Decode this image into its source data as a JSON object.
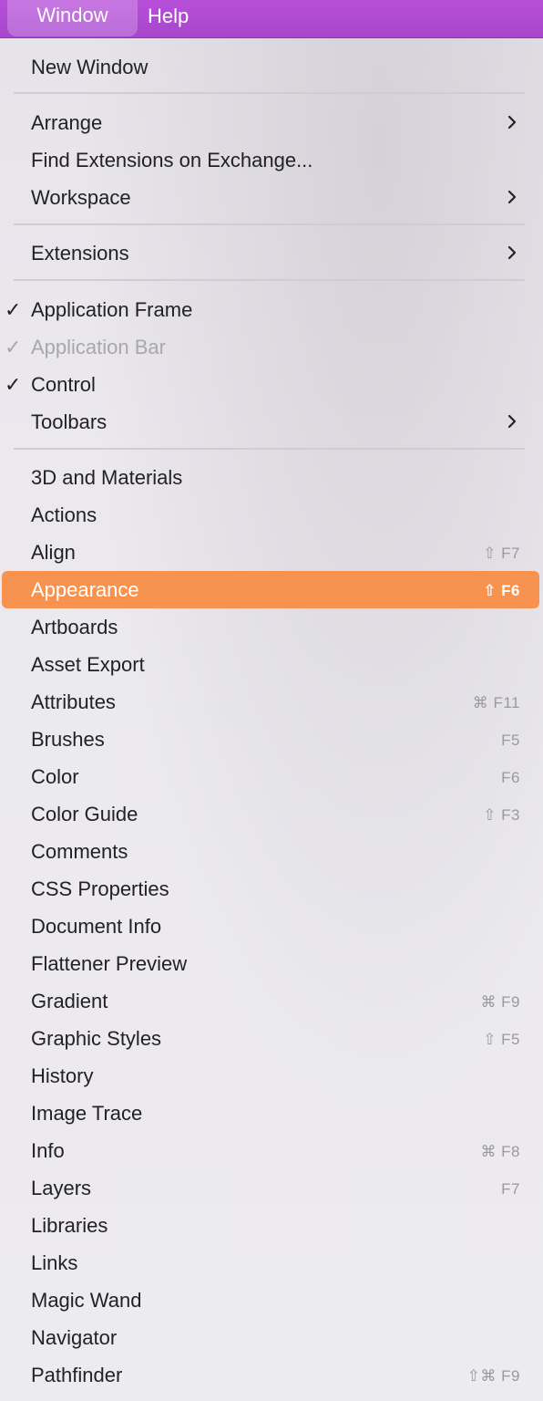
{
  "menubar": {
    "window_label": "Window",
    "help_label": "Help"
  },
  "menu": {
    "items": [
      {
        "label": "New Window"
      },
      {
        "label": "Arrange",
        "submenu": true
      },
      {
        "label": "Find Extensions on Exchange..."
      },
      {
        "label": "Workspace",
        "submenu": true
      },
      {
        "label": "Extensions",
        "submenu": true
      },
      {
        "label": "Application Frame",
        "checked": true
      },
      {
        "label": "Application Bar",
        "checked": true,
        "disabled": true
      },
      {
        "label": "Control",
        "checked": true
      },
      {
        "label": "Toolbars",
        "submenu": true
      },
      {
        "label": "3D and Materials"
      },
      {
        "label": "Actions"
      },
      {
        "label": "Align",
        "shortcut": "⇧ F7"
      },
      {
        "label": "Appearance",
        "shortcut": "⇧ F6",
        "highlighted": true
      },
      {
        "label": "Artboards"
      },
      {
        "label": "Asset Export"
      },
      {
        "label": "Attributes",
        "shortcut": "⌘ F11"
      },
      {
        "label": "Brushes",
        "shortcut": "F5"
      },
      {
        "label": "Color",
        "shortcut": "F6"
      },
      {
        "label": "Color Guide",
        "shortcut": "⇧ F3"
      },
      {
        "label": "Comments"
      },
      {
        "label": "CSS Properties"
      },
      {
        "label": "Document Info"
      },
      {
        "label": "Flattener Preview"
      },
      {
        "label": "Gradient",
        "shortcut": "⌘ F9"
      },
      {
        "label": "Graphic Styles",
        "shortcut": "⇧ F5"
      },
      {
        "label": "History"
      },
      {
        "label": "Image Trace"
      },
      {
        "label": "Info",
        "shortcut": "⌘ F8"
      },
      {
        "label": "Layers",
        "shortcut": "F7"
      },
      {
        "label": "Libraries"
      },
      {
        "label": "Links"
      },
      {
        "label": "Magic Wand"
      },
      {
        "label": "Navigator"
      },
      {
        "label": "Pathfinder",
        "shortcut": "⇧⌘ F9"
      }
    ],
    "check_glyph": "✓",
    "chevron_icon": "chevron-right-icon"
  },
  "colors": {
    "menubar_bg": "#b84fd8",
    "highlight_bg": "#f7934f",
    "menu_bg": "#ebe9ee"
  }
}
